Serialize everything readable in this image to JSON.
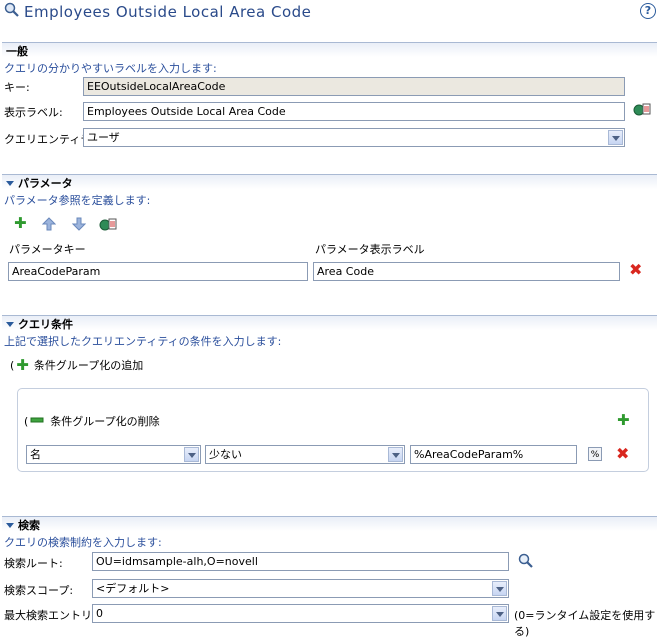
{
  "header": {
    "title": "Employees Outside Local Area Code",
    "help_glyph": "?"
  },
  "general": {
    "heading": "一般",
    "description": "クエリの分かりやすいラベルを入力します:",
    "key_label": "キー:",
    "key_value": "EEOutsideLocalAreaCode",
    "display_label_label": "表示ラベル:",
    "display_label_value": "Employees Outside Local Area Code",
    "entity_label": "クエリエンティティ:",
    "entity_value": "ユーザ"
  },
  "parameters": {
    "heading": "パラメータ",
    "description": "パラメータ参照を定義します:",
    "col_key": "パラメータキー",
    "col_display": "パラメータ表示ラベル",
    "rows": [
      {
        "key": "AreaCodeParam",
        "display": "Area Code"
      }
    ]
  },
  "conditions": {
    "heading": "クエリ条件",
    "description": "上記で選択したクエリエンティティの条件を入力します:",
    "add_group_label": "条件グループ化の追加",
    "remove_group_label": "条件グループ化の削除",
    "attribute_value": "名",
    "operator_value": "少ない",
    "value_value": "%AreaCodeParam%",
    "paren_glyph": "("
  },
  "search": {
    "heading": "検索",
    "description": "クエリの検索制約を入力します:",
    "root_label": "検索ルート:",
    "root_value": "OU=idmsample-alh,O=novell",
    "scope_label": "検索スコープ:",
    "scope_value": "<デフォルト>",
    "max_label": "最大検索エントリ:",
    "max_value": "0",
    "max_hint": "(0=ランタイム設定を使用する)"
  },
  "colors": {
    "accent": "#2b5b9c",
    "delete": "#d9271f",
    "add": "#2f9a2f",
    "readonly_bg": "#ebe8e0"
  }
}
